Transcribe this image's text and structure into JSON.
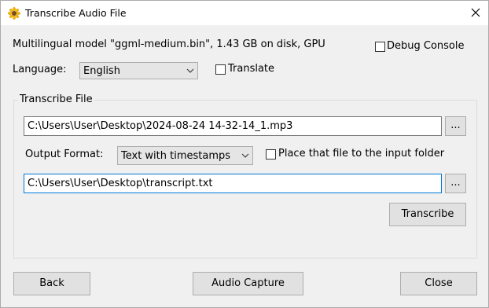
{
  "window": {
    "title": "Transcribe Audio File",
    "app_icon": "sunflower-icon",
    "close_icon": "close-icon"
  },
  "model_info": "Multilingual model \"ggml-medium.bin\", 1.43 GB on disk, GPU",
  "debug_console": {
    "label": "Debug Console",
    "checked": false
  },
  "language": {
    "label": "Language:",
    "value": "English"
  },
  "translate": {
    "label": "Translate",
    "checked": false
  },
  "transcribe_file": {
    "group_label": "Transcribe File",
    "input_path": "C:\\Users\\User\\Desktop\\2024-08-24 14-32-14_1.mp3",
    "browse_input_label": "...",
    "output_format_label": "Output Format:",
    "output_format_value": "Text with timestamps",
    "place_in_input_folder": {
      "label": "Place that file to the input folder",
      "checked": false
    },
    "output_path": "C:\\Users\\User\\Desktop\\transcript.txt",
    "browse_output_label": "...",
    "transcribe_button": "Transcribe"
  },
  "footer": {
    "back_button": "Back",
    "audio_capture_button": "Audio Capture",
    "close_button": "Close"
  },
  "colors": {
    "focus_border": "#0078d7",
    "button_face": "#e1e1e1"
  }
}
